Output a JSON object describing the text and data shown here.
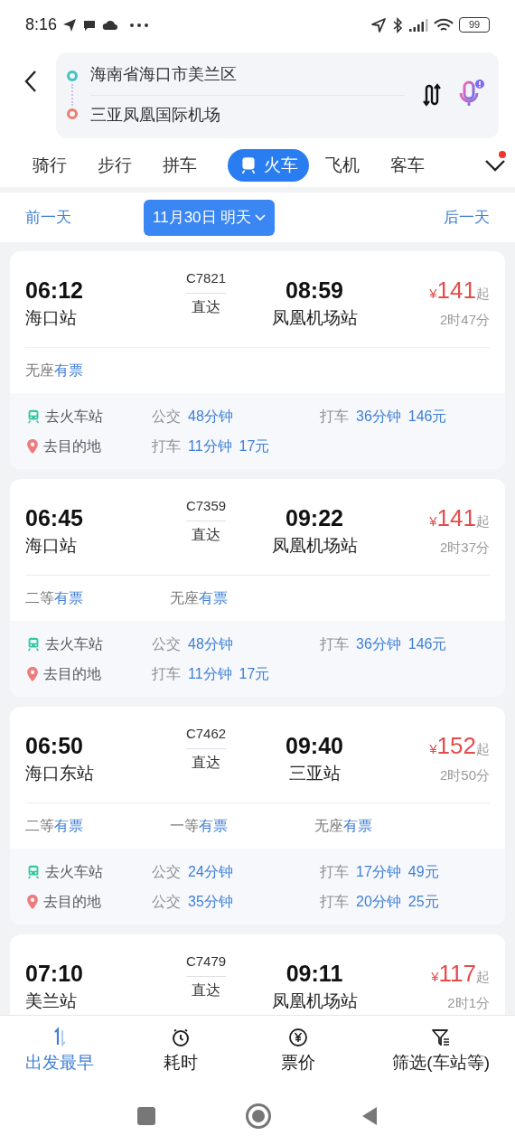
{
  "status_bar": {
    "time": "8:16",
    "battery": "99"
  },
  "route": {
    "origin": "海南省海口市美兰区",
    "destination": "三亚凤凰国际机场"
  },
  "modes": [
    {
      "label": "骑行",
      "selected": false
    },
    {
      "label": "步行",
      "selected": false
    },
    {
      "label": "拼车",
      "selected": false
    },
    {
      "label": "火车",
      "selected": true
    },
    {
      "label": "飞机",
      "selected": false
    },
    {
      "label": "客车",
      "selected": false
    }
  ],
  "date_bar": {
    "prev": "前一天",
    "date": "11月30日 明天",
    "next": "后一天"
  },
  "trains": [
    {
      "depart_time": "06:12",
      "depart_station": "海口站",
      "number": "C7821",
      "type": "直达",
      "arrive_time": "08:59",
      "arrive_station": "凤凰机场站",
      "currency": "¥",
      "price": "141",
      "price_suffix": "起",
      "duration": "2时47分",
      "seats": [
        {
          "class": "无座",
          "status": "有票"
        }
      ],
      "to_station": {
        "label": "去火车站",
        "options": [
          {
            "mode": "公交",
            "values": [
              "48分钟"
            ]
          },
          {
            "mode": "打车",
            "values": [
              "36分钟",
              "146元"
            ]
          }
        ]
      },
      "to_destination": {
        "label": "去目的地",
        "options": [
          {
            "mode": "打车",
            "values": [
              "11分钟",
              "17元"
            ]
          }
        ]
      }
    },
    {
      "depart_time": "06:45",
      "depart_station": "海口站",
      "number": "C7359",
      "type": "直达",
      "arrive_time": "09:22",
      "arrive_station": "凤凰机场站",
      "currency": "¥",
      "price": "141",
      "price_suffix": "起",
      "duration": "2时37分",
      "seats": [
        {
          "class": "二等",
          "status": "有票"
        },
        {
          "class": "无座",
          "status": "有票"
        }
      ],
      "to_station": {
        "label": "去火车站",
        "options": [
          {
            "mode": "公交",
            "values": [
              "48分钟"
            ]
          },
          {
            "mode": "打车",
            "values": [
              "36分钟",
              "146元"
            ]
          }
        ]
      },
      "to_destination": {
        "label": "去目的地",
        "options": [
          {
            "mode": "打车",
            "values": [
              "11分钟",
              "17元"
            ]
          }
        ]
      }
    },
    {
      "depart_time": "06:50",
      "depart_station": "海口东站",
      "number": "C7462",
      "type": "直达",
      "arrive_time": "09:40",
      "arrive_station": "三亚站",
      "currency": "¥",
      "price": "152",
      "price_suffix": "起",
      "duration": "2时50分",
      "seats": [
        {
          "class": "二等",
          "status": "有票"
        },
        {
          "class": "一等",
          "status": "有票"
        },
        {
          "class": "无座",
          "status": "有票"
        }
      ],
      "to_station": {
        "label": "去火车站",
        "options": [
          {
            "mode": "公交",
            "values": [
              "24分钟"
            ]
          },
          {
            "mode": "打车",
            "values": [
              "17分钟",
              "49元"
            ]
          }
        ]
      },
      "to_destination": {
        "label": "去目的地",
        "options": [
          {
            "mode": "公交",
            "values": [
              "35分钟"
            ]
          },
          {
            "mode": "打车",
            "values": [
              "20分钟",
              "25元"
            ]
          }
        ]
      }
    },
    {
      "depart_time": "07:10",
      "depart_station": "美兰站",
      "number": "C7479",
      "type": "直达",
      "arrive_time": "09:11",
      "arrive_station": "凤凰机场站",
      "currency": "¥",
      "price": "117",
      "price_suffix": "起",
      "duration": "2时1分"
    }
  ],
  "sort_tabs": [
    {
      "label": "出发最早",
      "kind": "earliest",
      "selected": true
    },
    {
      "label": "耗时",
      "kind": "duration",
      "selected": false
    },
    {
      "label": "票价",
      "kind": "price",
      "selected": false
    },
    {
      "label": "筛选(车站等)",
      "kind": "filter",
      "selected": false
    }
  ]
}
